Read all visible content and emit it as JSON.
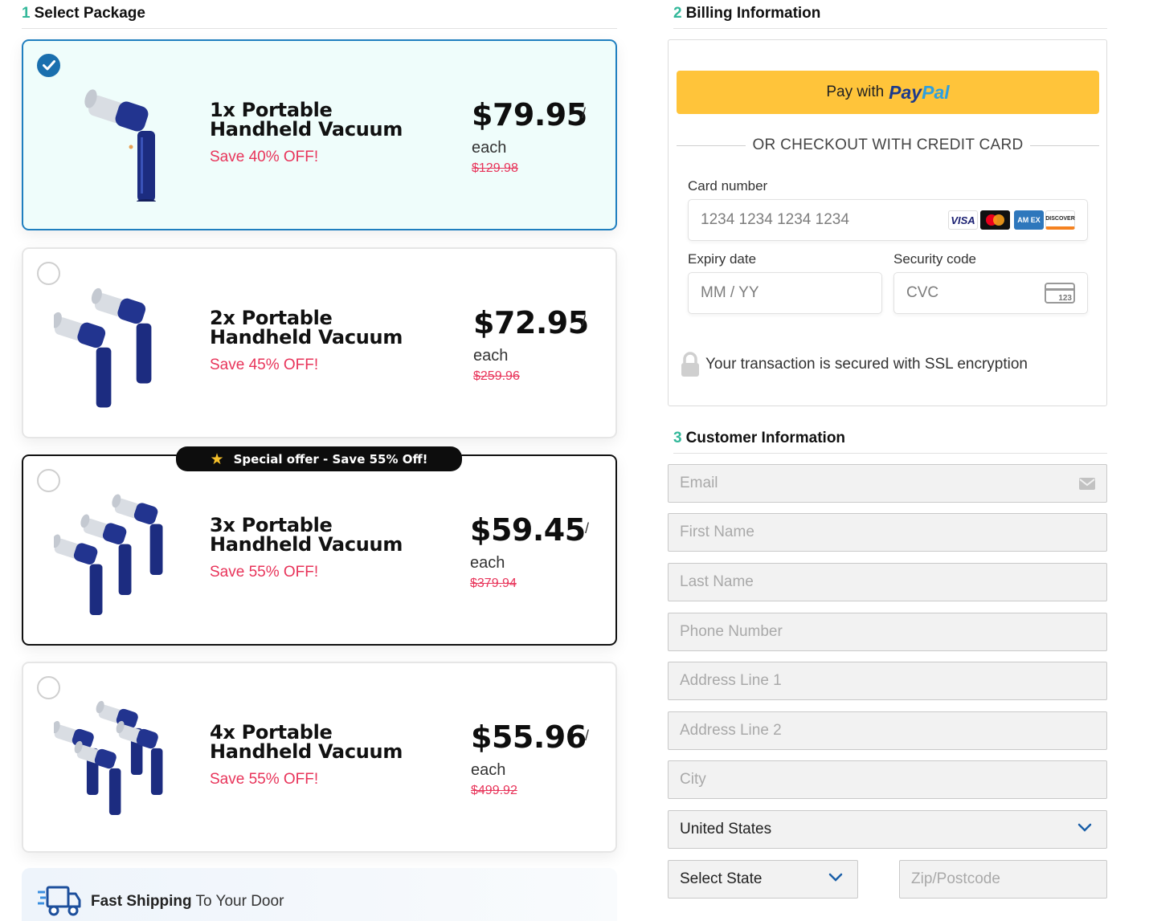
{
  "sections": {
    "package": {
      "num": "1",
      "title": "Select Package"
    },
    "billing": {
      "num": "2",
      "title": "Billing Information"
    },
    "customer": {
      "num": "3",
      "title": "Customer Information"
    }
  },
  "packages": [
    {
      "title": "1x Portable Handheld Vacuum",
      "save": "Save 40% OFF!",
      "price": "$79.95",
      "slash": "/",
      "each": "each",
      "old": "$129.98",
      "selected": true
    },
    {
      "title": "2x Portable Handheld Vacuum",
      "save": "Save 45% OFF!",
      "price": "$72.95",
      "slash": "/",
      "each": "each",
      "old": "$259.96",
      "selected": false
    },
    {
      "title": "3x Portable Handheld Vacuum",
      "save": "Save 55% OFF!",
      "price": "$59.45",
      "slash": "/",
      "each": "each",
      "old": "$379.94",
      "selected": false
    },
    {
      "title": "4x Portable Handheld Vacuum",
      "save": "Save 55% OFF!",
      "price": "$55.96",
      "slash": "/",
      "each": "each",
      "old": "$499.92",
      "selected": false
    }
  ],
  "special_badge": "Special offer - Save 55% Off!",
  "shipping": {
    "bold": "Fast Shipping",
    "rest": " To Your Door"
  },
  "billing": {
    "paypal_prefix": "Pay with",
    "paypal_brand_1": "Pay",
    "paypal_brand_2": "Pal",
    "or_text": "OR CHECKOUT WITH CREDIT CARD",
    "card_number_label": "Card number",
    "card_number_placeholder": "1234 1234 1234 1234",
    "expiry_label": "Expiry date",
    "expiry_placeholder": "MM / YY",
    "security_label": "Security code",
    "security_placeholder": "CVC",
    "cvc_icon_text": "123",
    "ssl_text": "Your transaction is secured with SSL encryption",
    "card_brands": [
      "VISA",
      "AM EX",
      "DISCOVER"
    ]
  },
  "customer": {
    "email": "Email",
    "first_name": "First Name",
    "last_name": "Last Name",
    "phone": "Phone Number",
    "address1": "Address Line 1",
    "address2": "Address Line 2",
    "city": "City",
    "country": "United States",
    "state": "Select State",
    "zip": "Zip/Postcode"
  },
  "colors": {
    "accent_teal": "#33b89a",
    "selected_border": "#1f7fbf",
    "save_red": "#e8345a",
    "paypal_yellow": "#ffc43a"
  }
}
